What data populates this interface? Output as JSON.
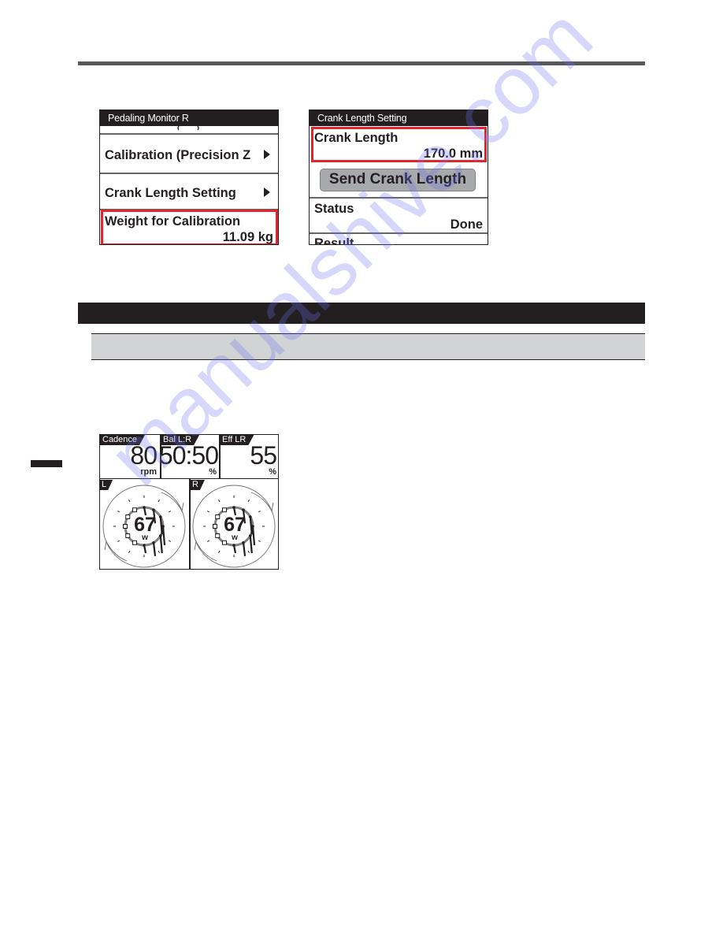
{
  "screen_crank_menu": {
    "title": "Pedaling Monitor R",
    "items": [
      {
        "label": "Calibration (Precision Z",
        "has_arrow": true
      },
      {
        "label": "Crank Length Setting",
        "has_arrow": true
      },
      {
        "label": "Weight for Calibration",
        "value": "11.09 kg",
        "highlighted": true
      }
    ]
  },
  "screen_crank_setting": {
    "title": "Crank Length Setting",
    "crank_length_label": "Crank Length",
    "crank_length_value": "170.0 mm",
    "send_button": "Send Crank Length",
    "status_label": "Status",
    "status_value": "Done",
    "result_label": "Result"
  },
  "pedaling_monitor": {
    "cadence": {
      "label": "Cadence",
      "value": "80",
      "unit": "rpm"
    },
    "balance": {
      "label": "Bal L:R",
      "value": "50:50",
      "unit": "%"
    },
    "efficiency": {
      "label": "Eff LR",
      "value": "55",
      "unit": "%"
    },
    "left": {
      "label": "L",
      "power": "67",
      "unit": "w"
    },
    "right": {
      "label": "R",
      "power": "67",
      "unit": "w"
    }
  },
  "colors": {
    "highlight": "#e3242b",
    "dark": "#231f20",
    "section_gray": "#d1d3d4",
    "button_gray": "#a7a9ac"
  },
  "watermark": "manualshive.com"
}
